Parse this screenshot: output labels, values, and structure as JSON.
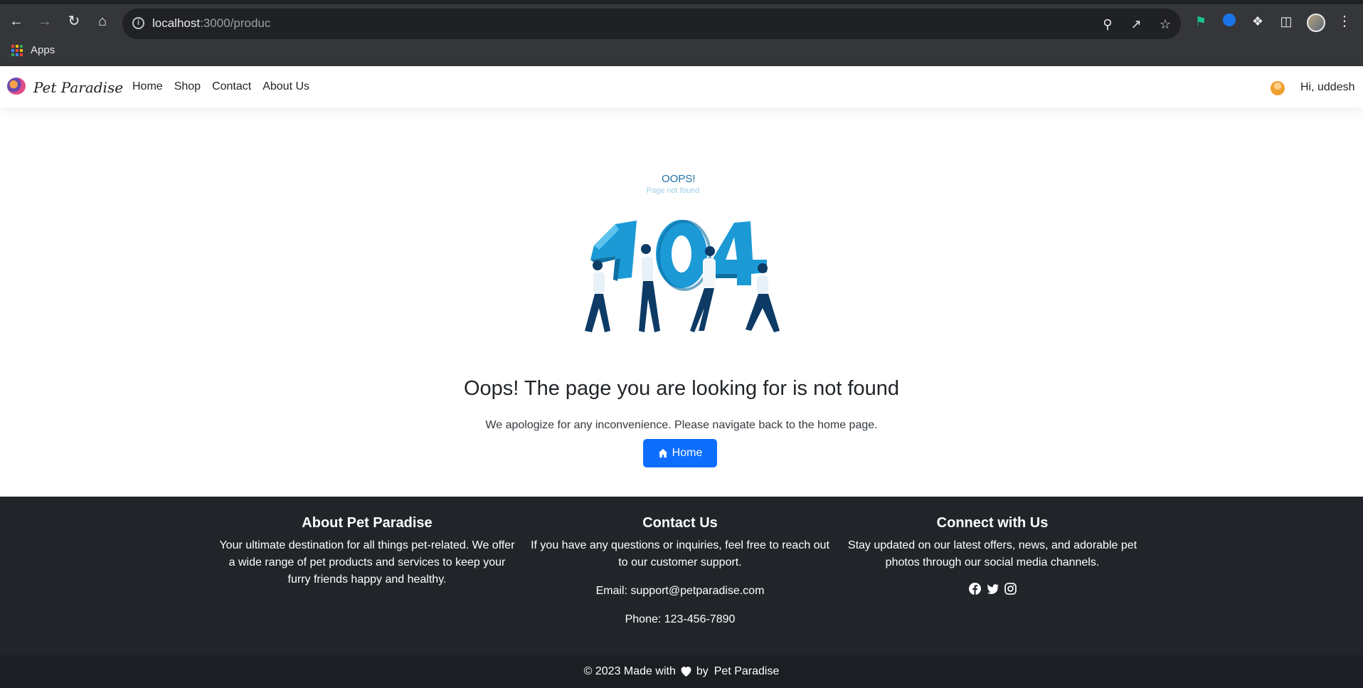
{
  "browser": {
    "url_host": "localhost",
    "url_rest": ":3000/produc",
    "bookmarks_apps_label": "Apps"
  },
  "navbar": {
    "brand": "Pet Paradise",
    "links": [
      "Home",
      "Shop",
      "Contact",
      "About Us"
    ],
    "greeting": "Hi, uddesh"
  },
  "main": {
    "oops": "OOPS!",
    "oops_sub": "Page not found",
    "title": "Oops! The page you are looking for is not found",
    "message": "We apologize for any inconvenience. Please navigate back to the home page.",
    "home_button": "Home",
    "accent_color": "#0d6efd"
  },
  "footer": {
    "about": {
      "title": "About Pet Paradise",
      "text": "Your ultimate destination for all things pet-related. We offer a wide range of pet products and services to keep your furry friends happy and healthy."
    },
    "contact": {
      "title": "Contact Us",
      "text": "If you have any questions or inquiries, feel free to reach out to our customer support.",
      "email": "Email: support@petparadise.com",
      "phone": "Phone: 123-456-7890"
    },
    "connect": {
      "title": "Connect with Us",
      "text": "Stay updated on our latest offers, news, and adorable pet photos through our social media channels.",
      "icons": [
        "facebook-icon",
        "twitter-icon",
        "instagram-icon"
      ]
    },
    "copyright_prefix": "© 2023 Made with",
    "copyright_by": "by",
    "copyright_brand": "Pet Paradise",
    "background": "#212529"
  }
}
